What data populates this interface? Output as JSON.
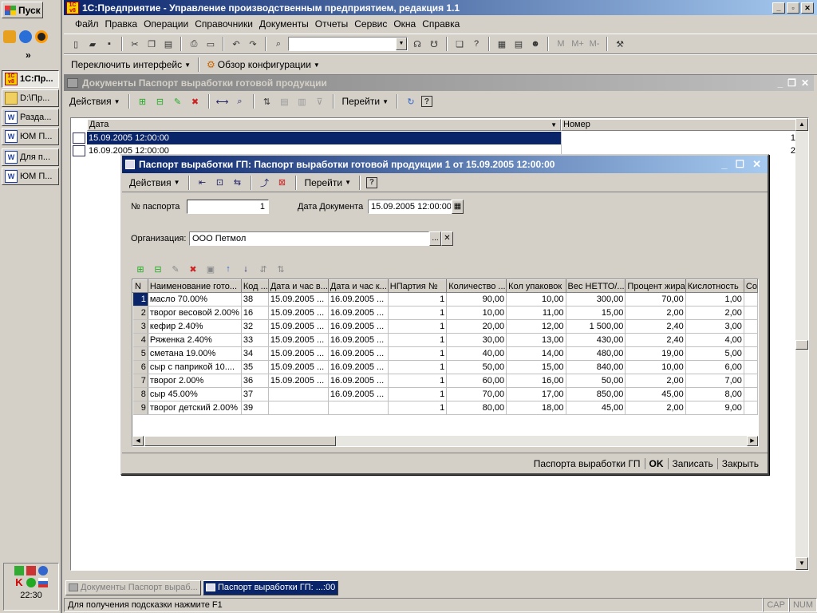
{
  "taskbar": {
    "start_label": "Пуск",
    "more_label": "»",
    "items": [
      {
        "label": "1С:Пр..."
      },
      {
        "label": "D:\\Пр..."
      },
      {
        "label": "Разда..."
      },
      {
        "label": "ЮМ П..."
      },
      {
        "label": "Для п..."
      },
      {
        "label": "ЮМ П..."
      }
    ],
    "clock": "22:30"
  },
  "app": {
    "title": "1С:Предприятие - Управление производственным предприятием, редакция 1.1",
    "menu": [
      "Файл",
      "Правка",
      "Операции",
      "Справочники",
      "Документы",
      "Отчеты",
      "Сервис",
      "Окна",
      "Справка"
    ],
    "toolbar2": {
      "switch_interface": "Переключить интерфейс",
      "config_overview": "Обзор конфигурации"
    },
    "memory_buttons": [
      "M",
      "M+",
      "M-"
    ]
  },
  "list_window": {
    "title": "Документы Паспорт выработки готовой продукции",
    "actions_label": "Действия",
    "goto_label": "Перейти",
    "columns": [
      "Дата",
      "Номер"
    ],
    "rows": [
      {
        "date": "15.09.2005 12:00:00",
        "number": "1"
      },
      {
        "date": "16.09.2005 12:00:00",
        "number": "2"
      }
    ]
  },
  "doc_window": {
    "title": "Паспорт выработки ГП: Паспорт выработки готовой продукции 1 от 15.09.2005 12:00:00",
    "actions_label": "Действия",
    "goto_label": "Перейти",
    "passport_label": "№ паспорта",
    "passport_value": "1",
    "doc_date_label": "Дата Документа",
    "doc_date_value": "15.09.2005 12:00:00",
    "org_label": "Организация:",
    "org_value": "ООО Петмол",
    "columns": [
      "N",
      "Наименование гото...",
      "Код ...",
      "Дата и час в...",
      "Дата и час к...",
      "НПартия №",
      "Количество ...",
      "Кол упаковок",
      "Вес НЕТТО/...",
      "Процент жира",
      "Кислотность",
      "Со"
    ],
    "rows": [
      [
        "1",
        "масло 70.00%",
        "38",
        "15.09.2005 ...",
        "16.09.2005 ...",
        "1",
        "90,00",
        "10,00",
        "300,00",
        "70,00",
        "1,00"
      ],
      [
        "2",
        "творог весовой 2.00%",
        "16",
        "15.09.2005 ...",
        "16.09.2005 ...",
        "1",
        "10,00",
        "11,00",
        "15,00",
        "2,00",
        "2,00"
      ],
      [
        "3",
        "кефир 2.40%",
        "32",
        "15.09.2005 ...",
        "16.09.2005 ...",
        "1",
        "20,00",
        "12,00",
        "1 500,00",
        "2,40",
        "3,00"
      ],
      [
        "4",
        "Ряженка 2.40%",
        "33",
        "15.09.2005 ...",
        "16.09.2005 ...",
        "1",
        "30,00",
        "13,00",
        "430,00",
        "2,40",
        "4,00"
      ],
      [
        "5",
        "сметана 19.00%",
        "34",
        "15.09.2005 ...",
        "16.09.2005 ...",
        "1",
        "40,00",
        "14,00",
        "480,00",
        "19,00",
        "5,00"
      ],
      [
        "6",
        "сыр с паприкой 10....",
        "35",
        "15.09.2005 ...",
        "16.09.2005 ...",
        "1",
        "50,00",
        "15,00",
        "840,00",
        "10,00",
        "6,00"
      ],
      [
        "7",
        "творог 2.00%",
        "36",
        "15.09.2005 ...",
        "16.09.2005 ...",
        "1",
        "60,00",
        "16,00",
        "50,00",
        "2,00",
        "7,00"
      ],
      [
        "8",
        "сыр 45.00%",
        "37",
        "",
        "16.09.2005 ...",
        "1",
        "70,00",
        "17,00",
        "850,00",
        "45,00",
        "8,00"
      ],
      [
        "9",
        "творог детский 2.00%",
        "39",
        "",
        "",
        "1",
        "80,00",
        "18,00",
        "45,00",
        "2,00",
        "9,00"
      ]
    ],
    "footer": {
      "print_label": "Паспорта выработки ГП",
      "ok_label": "OK",
      "save_label": "Записать",
      "close_label": "Закрыть"
    }
  },
  "window_tabs": [
    {
      "label": "Документы Паспорт выраб..."
    },
    {
      "label": "Паспорт выработки ГП: ...:00"
    }
  ],
  "status": {
    "hint": "Для получения подсказки нажмите F1",
    "caps": "CAP",
    "num": "NUM"
  }
}
